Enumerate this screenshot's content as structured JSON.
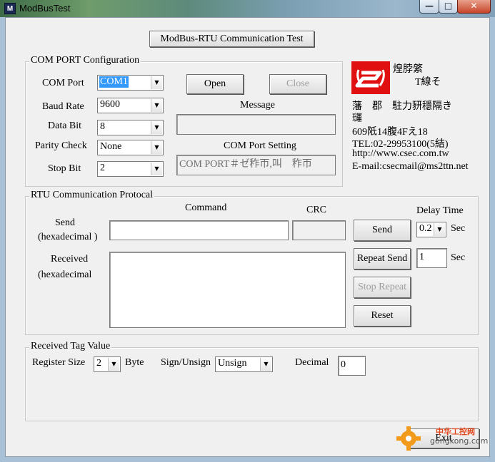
{
  "window": {
    "title": "ModBusTest",
    "icon": "modbus-app-icon"
  },
  "header": {
    "title_button": "ModBus-RTU Communication Test"
  },
  "com_port": {
    "group_label": "COM PORT Configuration",
    "port_label": "COM Port",
    "port_value": "COM1",
    "baud_label": "Baud Rate",
    "baud_value": "9600",
    "databit_label": "Data Bit",
    "databit_value": "8",
    "parity_label": "Parity Check",
    "parity_value": "None",
    "stopbit_label": "Stop Bit",
    "stopbit_value": "2",
    "open_button": "Open",
    "close_button": "Close",
    "message_label": "Message",
    "message_value": "",
    "setting_label": "COM Port Setting",
    "setting_value": "COM PORT＃ゼ秨帀,叫　秨帀"
  },
  "company": {
    "name_line1": "煌脖綮",
    "name_line2": "T線そ",
    "line3": "藩　郡　駐力豜穩隔き",
    "line4": "璭",
    "address": "609阺14腹4Fえ18",
    "tel": "TEL:02-29953100(5結)",
    "web": "http://www.csec.com.tw",
    "email": "E-mail:csecmail@ms2ttn.net"
  },
  "rtu": {
    "group_label": "RTU Communication Protocal",
    "command_label": "Command",
    "crc_label": "CRC",
    "delay_label": "Delay Time",
    "send_label_1": "Send",
    "send_label_2": "(hexadecimal )",
    "received_label_1": "Received",
    "received_label_2": "(hexadecimal",
    "command_value": "",
    "crc_value": "",
    "send_button": "Send",
    "repeat_button": "Repeat Send",
    "stop_button": "Stop Repeat",
    "reset_button": "Reset",
    "delay_value": "0.2",
    "sec_label": "Sec",
    "repeat_value": "1",
    "sec_label_2": "Sec",
    "received_value": ""
  },
  "tag": {
    "group_label": "Received Tag Value",
    "register_label": "Register Size",
    "register_value": "2",
    "byte_label": "Byte",
    "sign_label": "Sign/Unsign",
    "sign_value": "Unsign",
    "decimal_label": "Decimal",
    "decimal_value": "0"
  },
  "footer": {
    "exit_button": "Exit",
    "watermark_text": "中华工控网",
    "watermark_url": "gongkong.com"
  },
  "colors": {
    "logo_red": "#e01010",
    "selection_blue": "#3399ff",
    "client_bg": "#f0f0f0"
  }
}
